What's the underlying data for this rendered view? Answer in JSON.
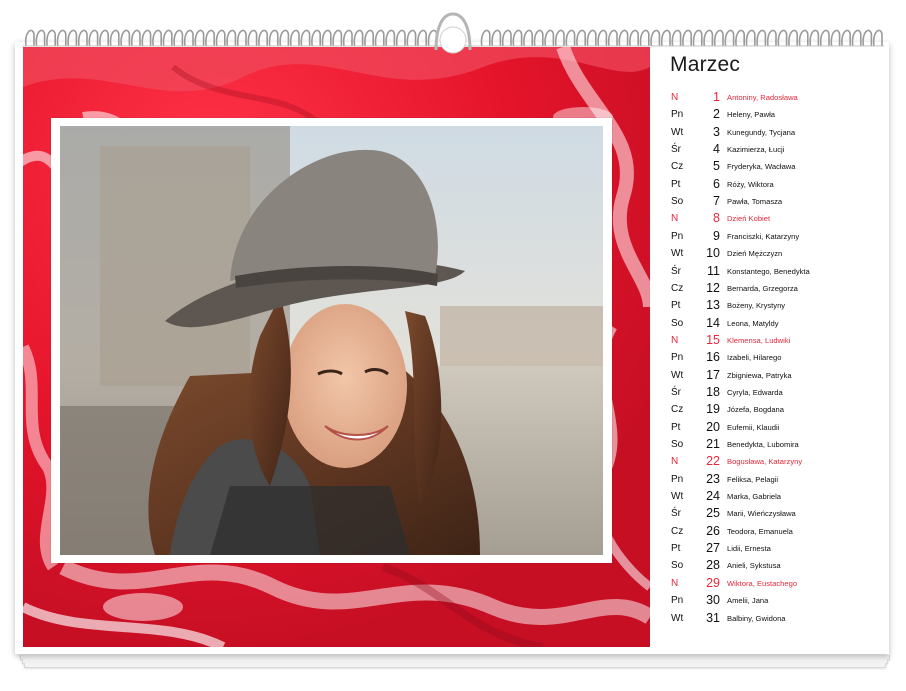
{
  "calendar": {
    "month": "Marzec",
    "colors": {
      "sunday": "#e3293b",
      "text": "#111111",
      "background_art": "#e8192e"
    },
    "days": [
      {
        "dow": "N",
        "num": "1",
        "names": "Antoniny, Radosława",
        "sunday": true
      },
      {
        "dow": "Pn",
        "num": "2",
        "names": "Heleny, Pawła",
        "sunday": false
      },
      {
        "dow": "Wt",
        "num": "3",
        "names": "Kunegundy, Tycjana",
        "sunday": false
      },
      {
        "dow": "Śr",
        "num": "4",
        "names": "Kazimierza, Łucji",
        "sunday": false
      },
      {
        "dow": "Cz",
        "num": "5",
        "names": "Fryderyka, Wacława",
        "sunday": false
      },
      {
        "dow": "Pt",
        "num": "6",
        "names": "Róży, Wiktora",
        "sunday": false
      },
      {
        "dow": "So",
        "num": "7",
        "names": "Pawła, Tomasza",
        "sunday": false
      },
      {
        "dow": "N",
        "num": "8",
        "names": "Dzień Kobiet",
        "sunday": true
      },
      {
        "dow": "Pn",
        "num": "9",
        "names": "Franciszki, Katarzyny",
        "sunday": false
      },
      {
        "dow": "Wt",
        "num": "10",
        "names": "Dzień Mężczyzn",
        "sunday": false
      },
      {
        "dow": "Śr",
        "num": "11",
        "names": "Konstantego, Benedykta",
        "sunday": false
      },
      {
        "dow": "Cz",
        "num": "12",
        "names": "Bernarda, Grzegorza",
        "sunday": false
      },
      {
        "dow": "Pt",
        "num": "13",
        "names": "Bożeny, Krystyny",
        "sunday": false
      },
      {
        "dow": "So",
        "num": "14",
        "names": "Leona, Matyldy",
        "sunday": false
      },
      {
        "dow": "N",
        "num": "15",
        "names": "Klemensa, Ludwiki",
        "sunday": true
      },
      {
        "dow": "Pn",
        "num": "16",
        "names": "Izabeli, Hilarego",
        "sunday": false
      },
      {
        "dow": "Wt",
        "num": "17",
        "names": "Zbigniewa, Patryka",
        "sunday": false
      },
      {
        "dow": "Śr",
        "num": "18",
        "names": "Cyryla, Edwarda",
        "sunday": false
      },
      {
        "dow": "Cz",
        "num": "19",
        "names": "Józefa, Bogdana",
        "sunday": false
      },
      {
        "dow": "Pt",
        "num": "20",
        "names": "Eufemii, Klaudii",
        "sunday": false
      },
      {
        "dow": "So",
        "num": "21",
        "names": "Benedykta, Lubomira",
        "sunday": false
      },
      {
        "dow": "N",
        "num": "22",
        "names": "Bogusława, Katarzyny",
        "sunday": true
      },
      {
        "dow": "Pn",
        "num": "23",
        "names": "Feliksa, Pelagii",
        "sunday": false
      },
      {
        "dow": "Wt",
        "num": "24",
        "names": "Marka, Gabriela",
        "sunday": false
      },
      {
        "dow": "Śr",
        "num": "25",
        "names": "Marii, Wieńczysława",
        "sunday": false
      },
      {
        "dow": "Cz",
        "num": "26",
        "names": "Teodora, Emanuela",
        "sunday": false
      },
      {
        "dow": "Pt",
        "num": "27",
        "names": "Lidii, Ernesta",
        "sunday": false
      },
      {
        "dow": "So",
        "num": "28",
        "names": "Anieli, Sykstusa",
        "sunday": false
      },
      {
        "dow": "N",
        "num": "29",
        "names": "Wiktora, Eustachego",
        "sunday": true
      },
      {
        "dow": "Pn",
        "num": "30",
        "names": "Amelii, Jana",
        "sunday": false
      },
      {
        "dow": "Wt",
        "num": "31",
        "names": "Balbiny, Gwidona",
        "sunday": false
      }
    ]
  },
  "artwork": {
    "background": "red-white-marble-pattern",
    "photo": "smiling-woman-in-grey-hat-photo"
  }
}
